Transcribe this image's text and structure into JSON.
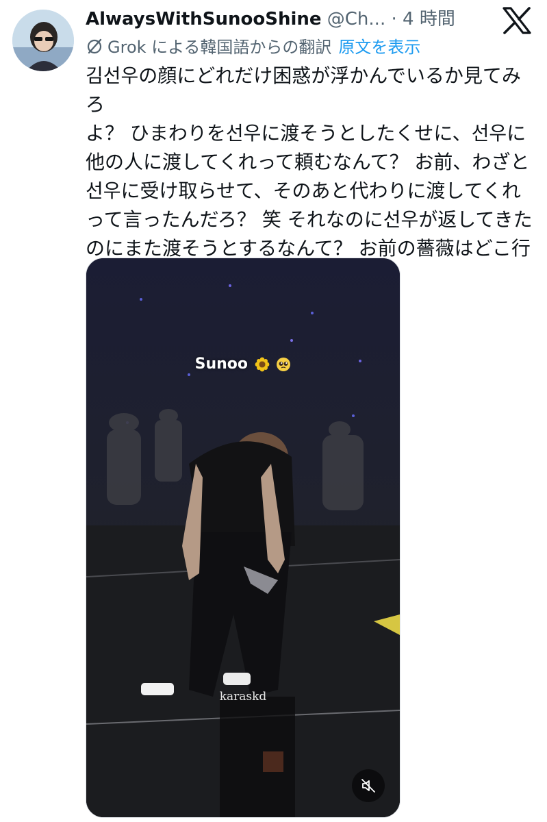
{
  "tweet": {
    "author": {
      "display_name": "AlwaysWithSunooShine",
      "handle": "@Ch...",
      "separator": "·",
      "time": "4 時間",
      "avatar_icon": "avatar-photo"
    },
    "platform_icon": "x-logo-icon",
    "translation": {
      "icon": "grok-icon",
      "label": "Grok による韓国語からの翻訳",
      "show_original": "原文を表示"
    },
    "text": "김선우の顔にどれだけ困惑が浮かんでいるか見てみろ\nよ？ ひまわりを선우に渡そうとしたくせに、선우に\n他の人に渡してくれって頼むなんて？ お前、わざと\n선우に受け取らせて、そのあと代わりに渡してくれ\nって言ったんだろ？ 笑 それなのに선우が返してきた\nのにまた渡そうとするなんて？ お前の薔薇はどこ行\nったんだよ？",
    "media": {
      "type": "video",
      "caption_text": "Sunoo",
      "caption_emojis": [
        "sunflower-icon",
        "pleading-face-icon"
      ],
      "watermark": "karaskd",
      "mute_icon": "speaker-muted-icon"
    }
  },
  "colors": {
    "text_primary": "#0f1419",
    "text_secondary": "#536471",
    "link": "#1d9bf0",
    "stage_background": "#1a1d2e"
  }
}
